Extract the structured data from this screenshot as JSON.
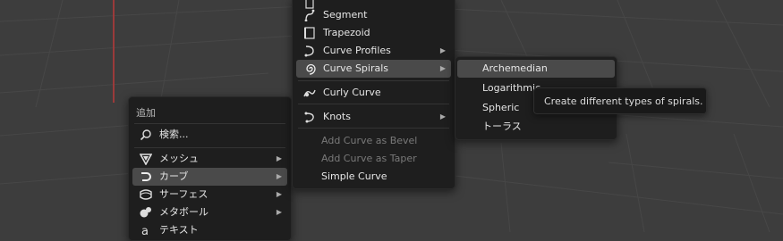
{
  "add_menu": {
    "header": "追加",
    "search_label": "検索...",
    "items": [
      {
        "label": "メッシュ",
        "icon": "mesh-icon",
        "has_submenu": true
      },
      {
        "label": "カーブ",
        "icon": "curve-icon",
        "has_submenu": true,
        "active": true
      },
      {
        "label": "サーフェス",
        "icon": "surface-icon",
        "has_submenu": true
      },
      {
        "label": "メタボール",
        "icon": "metaball-icon",
        "has_submenu": true
      },
      {
        "label": "テキスト",
        "icon": "text-icon",
        "has_submenu": false
      }
    ]
  },
  "curve_menu": {
    "items": [
      {
        "label": "Segment",
        "icon": "segment-icon"
      },
      {
        "label": "Trapezoid",
        "icon": "trapezoid-icon"
      },
      {
        "label": "Curve Profiles",
        "icon": "curve-profiles-icon",
        "has_submenu": true
      },
      {
        "label": "Curve Spirals",
        "icon": "spiral-icon",
        "has_submenu": true,
        "active": true
      },
      {
        "label": "Curly Curve",
        "icon": "curly-curve-icon"
      },
      {
        "label": "Knots",
        "icon": "knots-icon",
        "has_submenu": true
      },
      {
        "label": "Add Curve as Bevel",
        "disabled": true
      },
      {
        "label": "Add Curve as Taper",
        "disabled": true
      },
      {
        "label": "Simple Curve"
      }
    ]
  },
  "spirals_menu": {
    "items": [
      {
        "label": "Archemedian",
        "active": true
      },
      {
        "label": "Logarithmic"
      },
      {
        "label": "Spheric"
      },
      {
        "label": "トーラス"
      }
    ]
  },
  "tooltip": {
    "text": "Create different types of spirals."
  },
  "colors": {
    "background": "#3d3d3d",
    "menu_bg": "#1e1e1e",
    "highlight": "#4a4a4a",
    "x_axis": "#9b3a3a"
  }
}
